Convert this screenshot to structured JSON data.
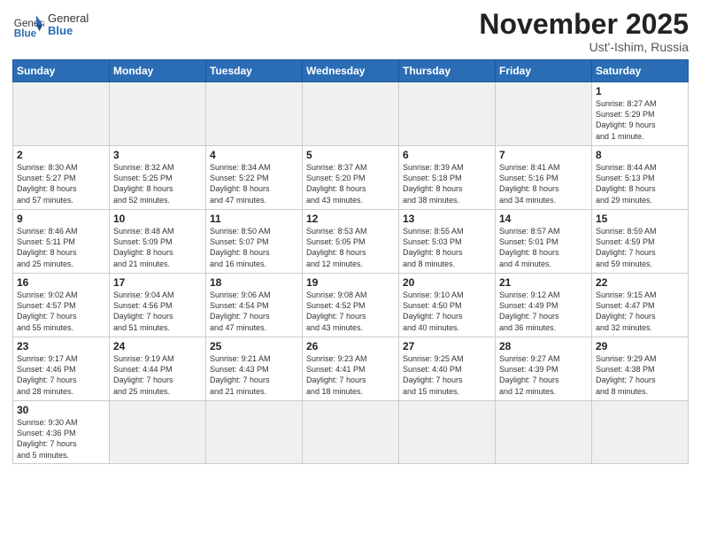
{
  "logo": {
    "text_general": "General",
    "text_blue": "Blue"
  },
  "title": "November 2025",
  "subtitle": "Ust'-Ishim, Russia",
  "weekdays": [
    "Sunday",
    "Monday",
    "Tuesday",
    "Wednesday",
    "Thursday",
    "Friday",
    "Saturday"
  ],
  "weeks": [
    [
      {
        "day": "",
        "info": ""
      },
      {
        "day": "",
        "info": ""
      },
      {
        "day": "",
        "info": ""
      },
      {
        "day": "",
        "info": ""
      },
      {
        "day": "",
        "info": ""
      },
      {
        "day": "",
        "info": ""
      },
      {
        "day": "1",
        "info": "Sunrise: 8:27 AM\nSunset: 5:29 PM\nDaylight: 9 hours\nand 1 minute."
      }
    ],
    [
      {
        "day": "2",
        "info": "Sunrise: 8:30 AM\nSunset: 5:27 PM\nDaylight: 8 hours\nand 57 minutes."
      },
      {
        "day": "3",
        "info": "Sunrise: 8:32 AM\nSunset: 5:25 PM\nDaylight: 8 hours\nand 52 minutes."
      },
      {
        "day": "4",
        "info": "Sunrise: 8:34 AM\nSunset: 5:22 PM\nDaylight: 8 hours\nand 47 minutes."
      },
      {
        "day": "5",
        "info": "Sunrise: 8:37 AM\nSunset: 5:20 PM\nDaylight: 8 hours\nand 43 minutes."
      },
      {
        "day": "6",
        "info": "Sunrise: 8:39 AM\nSunset: 5:18 PM\nDaylight: 8 hours\nand 38 minutes."
      },
      {
        "day": "7",
        "info": "Sunrise: 8:41 AM\nSunset: 5:16 PM\nDaylight: 8 hours\nand 34 minutes."
      },
      {
        "day": "8",
        "info": "Sunrise: 8:44 AM\nSunset: 5:13 PM\nDaylight: 8 hours\nand 29 minutes."
      }
    ],
    [
      {
        "day": "9",
        "info": "Sunrise: 8:46 AM\nSunset: 5:11 PM\nDaylight: 8 hours\nand 25 minutes."
      },
      {
        "day": "10",
        "info": "Sunrise: 8:48 AM\nSunset: 5:09 PM\nDaylight: 8 hours\nand 21 minutes."
      },
      {
        "day": "11",
        "info": "Sunrise: 8:50 AM\nSunset: 5:07 PM\nDaylight: 8 hours\nand 16 minutes."
      },
      {
        "day": "12",
        "info": "Sunrise: 8:53 AM\nSunset: 5:05 PM\nDaylight: 8 hours\nand 12 minutes."
      },
      {
        "day": "13",
        "info": "Sunrise: 8:55 AM\nSunset: 5:03 PM\nDaylight: 8 hours\nand 8 minutes."
      },
      {
        "day": "14",
        "info": "Sunrise: 8:57 AM\nSunset: 5:01 PM\nDaylight: 8 hours\nand 4 minutes."
      },
      {
        "day": "15",
        "info": "Sunrise: 8:59 AM\nSunset: 4:59 PM\nDaylight: 7 hours\nand 59 minutes."
      }
    ],
    [
      {
        "day": "16",
        "info": "Sunrise: 9:02 AM\nSunset: 4:57 PM\nDaylight: 7 hours\nand 55 minutes."
      },
      {
        "day": "17",
        "info": "Sunrise: 9:04 AM\nSunset: 4:56 PM\nDaylight: 7 hours\nand 51 minutes."
      },
      {
        "day": "18",
        "info": "Sunrise: 9:06 AM\nSunset: 4:54 PM\nDaylight: 7 hours\nand 47 minutes."
      },
      {
        "day": "19",
        "info": "Sunrise: 9:08 AM\nSunset: 4:52 PM\nDaylight: 7 hours\nand 43 minutes."
      },
      {
        "day": "20",
        "info": "Sunrise: 9:10 AM\nSunset: 4:50 PM\nDaylight: 7 hours\nand 40 minutes."
      },
      {
        "day": "21",
        "info": "Sunrise: 9:12 AM\nSunset: 4:49 PM\nDaylight: 7 hours\nand 36 minutes."
      },
      {
        "day": "22",
        "info": "Sunrise: 9:15 AM\nSunset: 4:47 PM\nDaylight: 7 hours\nand 32 minutes."
      }
    ],
    [
      {
        "day": "23",
        "info": "Sunrise: 9:17 AM\nSunset: 4:46 PM\nDaylight: 7 hours\nand 28 minutes."
      },
      {
        "day": "24",
        "info": "Sunrise: 9:19 AM\nSunset: 4:44 PM\nDaylight: 7 hours\nand 25 minutes."
      },
      {
        "day": "25",
        "info": "Sunrise: 9:21 AM\nSunset: 4:43 PM\nDaylight: 7 hours\nand 21 minutes."
      },
      {
        "day": "26",
        "info": "Sunrise: 9:23 AM\nSunset: 4:41 PM\nDaylight: 7 hours\nand 18 minutes."
      },
      {
        "day": "27",
        "info": "Sunrise: 9:25 AM\nSunset: 4:40 PM\nDaylight: 7 hours\nand 15 minutes."
      },
      {
        "day": "28",
        "info": "Sunrise: 9:27 AM\nSunset: 4:39 PM\nDaylight: 7 hours\nand 12 minutes."
      },
      {
        "day": "29",
        "info": "Sunrise: 9:29 AM\nSunset: 4:38 PM\nDaylight: 7 hours\nand 8 minutes."
      }
    ],
    [
      {
        "day": "30",
        "info": "Sunrise: 9:30 AM\nSunset: 4:36 PM\nDaylight: 7 hours\nand 5 minutes."
      },
      {
        "day": "",
        "info": ""
      },
      {
        "day": "",
        "info": ""
      },
      {
        "day": "",
        "info": ""
      },
      {
        "day": "",
        "info": ""
      },
      {
        "day": "",
        "info": ""
      },
      {
        "day": "",
        "info": ""
      }
    ]
  ]
}
